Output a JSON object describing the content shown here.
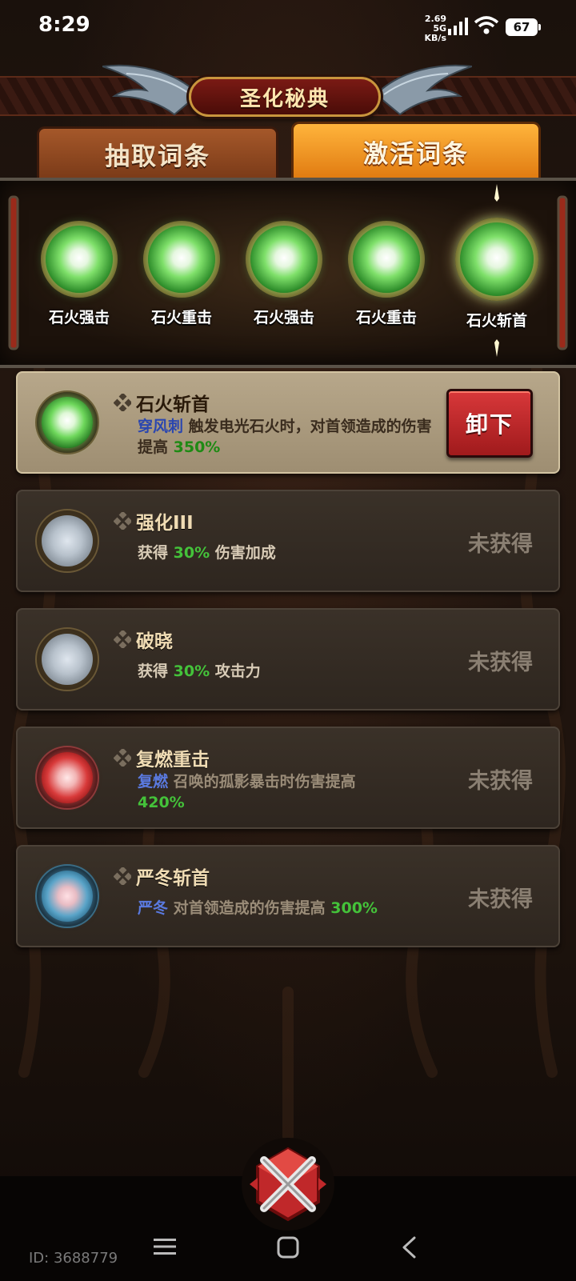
{
  "status_bar": {
    "time": "8:29",
    "net_speed_value": "2.69 5G",
    "net_speed_unit": "KB/s",
    "battery": "67",
    "icons": [
      "signal-icon",
      "wifi-icon",
      "battery-icon"
    ]
  },
  "header": {
    "title": "圣化秘典"
  },
  "tabs": [
    {
      "label": "抽取词条",
      "active": false
    },
    {
      "label": "激活词条",
      "active": true
    }
  ],
  "slots": [
    {
      "label": "石火强击",
      "color": "green"
    },
    {
      "label": "石火重击",
      "color": "green"
    },
    {
      "label": "石火强击",
      "color": "green"
    },
    {
      "label": "石火重击",
      "color": "green"
    },
    {
      "label": "石火斩首",
      "color": "green",
      "selected": true
    }
  ],
  "entries": [
    {
      "title": "石火斩首",
      "keyword": "穿风刺",
      "desc_text": " 触发电光石火时，对首领造成的伤害提高 ",
      "value": "350%",
      "action": "卸下",
      "active": true,
      "orb_color": "#6fd85c"
    },
    {
      "title": "强化III",
      "desc_prefix": "获得 ",
      "value": "30%",
      "desc_suffix": " 伤害加成",
      "status": "未获得",
      "orb_color": "#b8c2cc"
    },
    {
      "title": "破晓",
      "desc_prefix": "获得 ",
      "value": "30%",
      "desc_suffix": " 攻击力",
      "status": "未获得",
      "orb_color": "#b8c2cc"
    },
    {
      "title": "复燃重击",
      "keyword": "复燃",
      "desc_text": " 召唤的孤影暴击时伤害提高",
      "value": "420%",
      "status": "未获得",
      "orb_color": "#d83a3a"
    },
    {
      "title": "严冬斩首",
      "keyword": "严冬",
      "desc_text": " 对首领造成的伤害提高 ",
      "value": "300%",
      "status": "未获得",
      "orb_color": "#5aa4c8"
    }
  ],
  "footer": {
    "user_id": "ID: 3688779",
    "close_icon": "close-emblem-icon",
    "nav_icons": [
      "menu-icon",
      "home-icon",
      "back-icon"
    ]
  }
}
